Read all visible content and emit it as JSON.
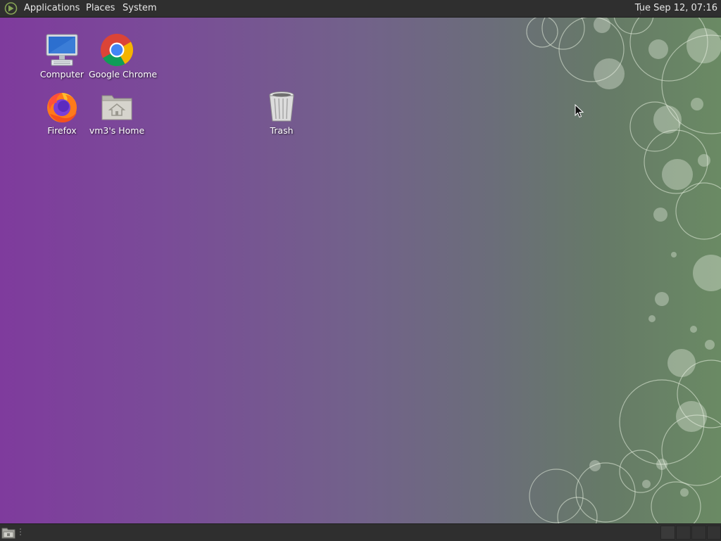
{
  "topbar": {
    "menus": [
      {
        "label": "Applications"
      },
      {
        "label": "Places"
      },
      {
        "label": "System"
      }
    ],
    "clock": "Tue Sep 12, 07:16",
    "logo_icon": "mate-logo-icon"
  },
  "desktop_icons": [
    {
      "label": "Computer",
      "icon": "computer-icon"
    },
    {
      "label": "Google Chrome",
      "icon": "chrome-icon"
    },
    {
      "label": "Firefox",
      "icon": "firefox-icon"
    },
    {
      "label": "vm3's Home",
      "icon": "home-folder-icon"
    },
    {
      "label": "Trash",
      "icon": "trash-icon"
    }
  ],
  "bottombar": {
    "show_desktop_icon": "show-desktop-icon",
    "workspaces": 4
  },
  "colors": {
    "panel": "#2f2f2f",
    "wallpaper_left": "#7f3b9d",
    "wallpaper_right": "#6a8a64"
  }
}
